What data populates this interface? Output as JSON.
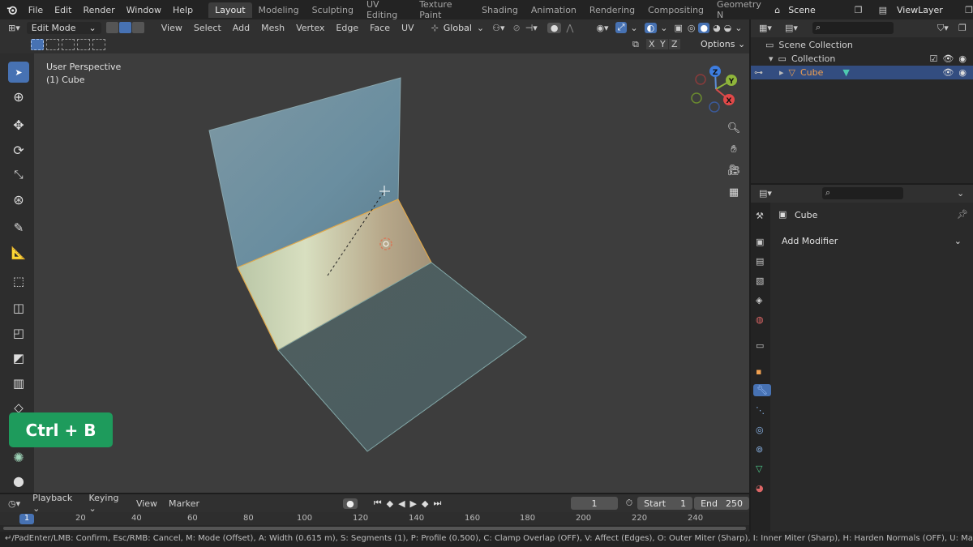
{
  "topbar": {
    "menus": [
      "File",
      "Edit",
      "Render",
      "Window",
      "Help"
    ],
    "workspaces": [
      "Layout",
      "Modeling",
      "Sculpting",
      "UV Editing",
      "Texture Paint",
      "Shading",
      "Animation",
      "Rendering",
      "Compositing",
      "Geometry N"
    ],
    "active_workspace": "Layout",
    "scene": "Scene",
    "view_layer": "ViewLayer"
  },
  "viewport_header": {
    "mode": "Edit Mode",
    "menus": [
      "View",
      "Select",
      "Add",
      "Mesh",
      "Vertex",
      "Edge",
      "Face",
      "UV"
    ],
    "orientation": "Global",
    "options": "Options",
    "axes": [
      "X",
      "Y",
      "Z"
    ]
  },
  "viewport": {
    "perspective": "User Perspective",
    "object": "(1) Cube",
    "gizmo_axes": [
      "Z",
      "Y",
      "X"
    ]
  },
  "outliner": {
    "root": "Scene Collection",
    "collection": "Collection",
    "object": "Cube"
  },
  "properties": {
    "object_name": "Cube",
    "add_modifier": "Add Modifier"
  },
  "timeline": {
    "menus": [
      "Playback",
      "Keying",
      "View",
      "Marker"
    ],
    "current_frame": "1",
    "start_label": "Start",
    "start": "1",
    "end_label": "End",
    "end": "250",
    "ruler": [
      "1",
      "20",
      "40",
      "60",
      "80",
      "100",
      "120",
      "140",
      "160",
      "180",
      "200",
      "220",
      "240"
    ]
  },
  "status": "↵/PadEnter/LMB: Confirm, Esc/RMB: Cancel, M: Mode (Offset), A: Width (0.615 m), S: Segments (1), P: Profile (0.500), C: Clamp Overlap (OFF), V: Affect (Edges), O: Outer Miter (Sharp), I: Inner Miter (Sharp), H: Harden Normals (OFF), U: Mark Seam (OFF), K: Mark Sharp (OFF)",
  "shortcut": "Ctrl + B",
  "colors": {
    "accent": "#4772b3",
    "shortcut_bg": "#1e9b5c",
    "selection": "#334d80"
  }
}
